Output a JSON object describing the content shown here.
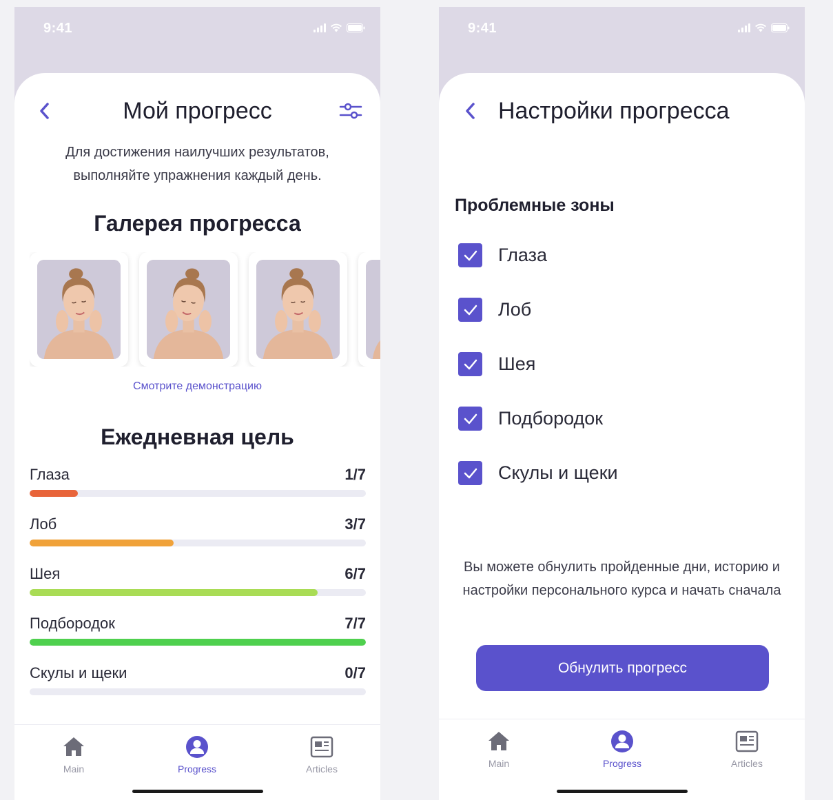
{
  "screen1": {
    "status_time": "9:41",
    "title": "Мой прогресс",
    "intro": "Для достижения наилучших результатов, выполняйте упражнения каждый день.",
    "gallery_title": "Галерея прогресса",
    "gallery_icons": [
      "face-photo-1",
      "face-photo-2",
      "face-photo-3",
      "face-photo-4"
    ],
    "demo_link": "Смотрите демонстрацию",
    "goal_title": "Ежедневная цель",
    "goals": [
      {
        "label": "Глаза",
        "value": "1/7",
        "progress": 0.1429,
        "color": "#e8643a"
      },
      {
        "label": "Лоб",
        "value": "3/7",
        "progress": 0.4286,
        "color": "#f0a23a"
      },
      {
        "label": "Шея",
        "value": "6/7",
        "progress": 0.8571,
        "color": "#a9dc55"
      },
      {
        "label": "Подбородок",
        "value": "7/7",
        "progress": 1.0,
        "color": "#4fd04e"
      },
      {
        "label": "Скулы и щеки",
        "value": "0/7",
        "progress": 0.0,
        "color": "#e8643a"
      }
    ]
  },
  "screen2": {
    "status_time": "9:41",
    "title": "Настройки прогресса",
    "zones_title": "Проблемные зоны",
    "zones": [
      {
        "label": "Глаза",
        "checked": true
      },
      {
        "label": "Лоб",
        "checked": true
      },
      {
        "label": "Шея",
        "checked": true
      },
      {
        "label": "Подбородок",
        "checked": true
      },
      {
        "label": "Скулы и щеки",
        "checked": true
      }
    ],
    "reset_text": "Вы можете обнулить пройденные дни, историю и настройки персонального курса и начать сначала",
    "reset_button": "Обнулить прогресс"
  },
  "tabs": [
    {
      "label": "Main",
      "icon": "home-icon",
      "active": false
    },
    {
      "label": "Progress",
      "icon": "user-icon",
      "active": true
    },
    {
      "label": "Articles",
      "icon": "articles-icon",
      "active": false
    }
  ],
  "colors": {
    "accent": "#5a52cc",
    "header_bg": "#ddd9e6",
    "track": "#ebebf3"
  }
}
